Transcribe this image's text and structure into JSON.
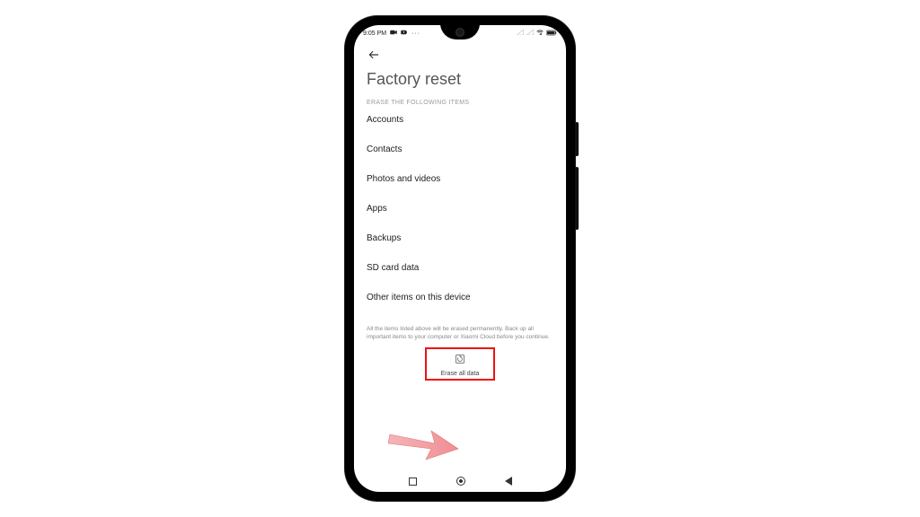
{
  "status": {
    "time": "9:05 PM"
  },
  "page": {
    "title": "Factory reset",
    "subheader": "ERASE THE FOLLOWING ITEMS",
    "items": [
      "Accounts",
      "Contacts",
      "Photos and videos",
      "Apps",
      "Backups",
      "SD card data",
      "Other items on this device"
    ],
    "footerNote": "All the items listed above will be erased permanently. Back up all important items to your computer or Xiaomi Cloud before you continue.",
    "eraseLabel": "Erase all data"
  },
  "callout": {
    "highlight": "erase-all-data-button"
  }
}
